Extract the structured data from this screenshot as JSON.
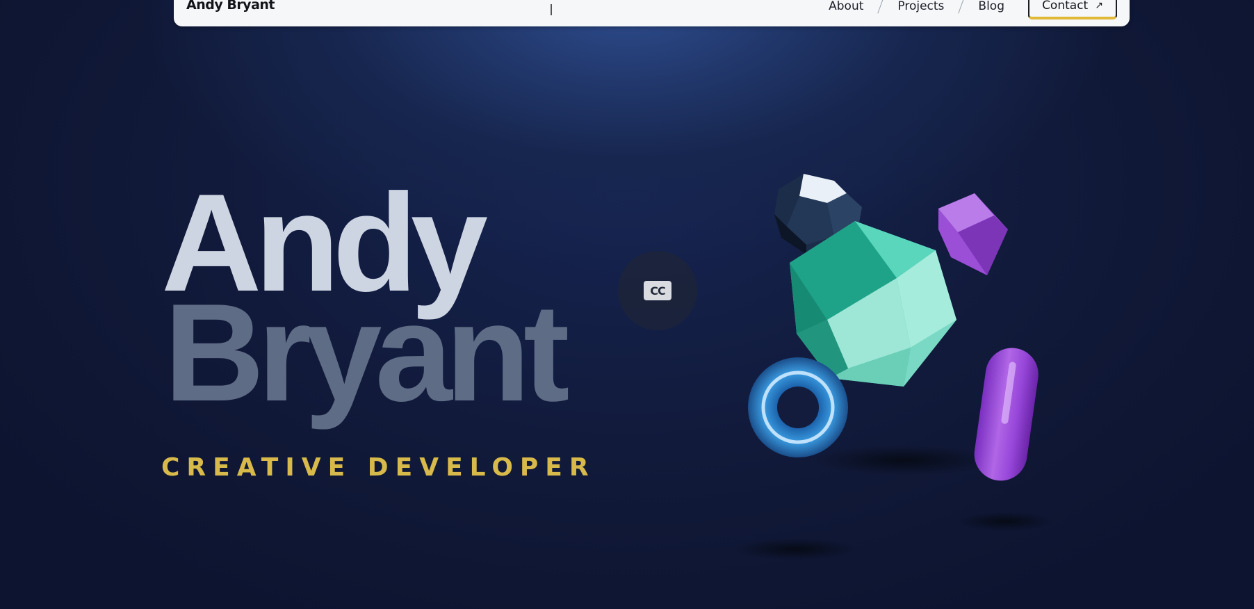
{
  "nav": {
    "brand": "Andy Bryant",
    "links": [
      "About",
      "Projects",
      "Blog"
    ],
    "contact_label": "Contact",
    "contact_icon": "arrow-up-right-icon"
  },
  "hero": {
    "first_name": "Andy",
    "last_name": "Bryant",
    "role": "CREATIVE DEVELOPER"
  },
  "cc": {
    "label": "CC",
    "icon": "closed-captions-icon"
  },
  "colors": {
    "background": "#0e1532",
    "accent": "#d8ba4a",
    "first_name": "#cdd5e3",
    "last_name": "#5f6c86",
    "nav_bg": "#f6f7f9"
  },
  "illustration": {
    "shapes": [
      "dark-dodecahedron",
      "teal-icosahedron",
      "purple-cube",
      "blue-torus",
      "purple-capsule"
    ]
  }
}
